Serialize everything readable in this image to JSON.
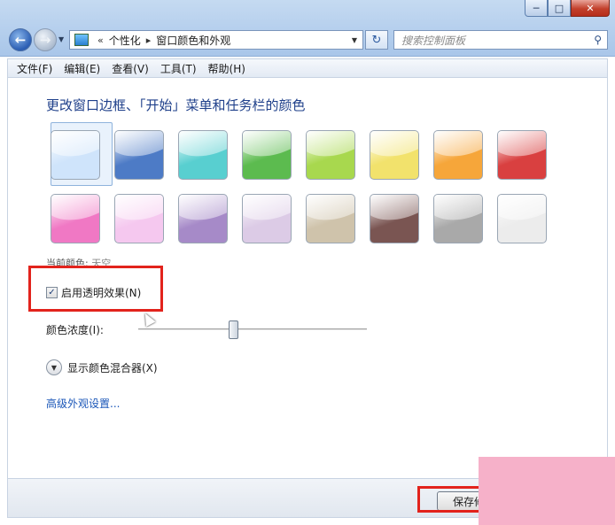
{
  "window": {
    "controls": {
      "minimize": "─",
      "maximize": "□",
      "close": "✕"
    }
  },
  "nav": {
    "back_icon": "back-arrow-icon",
    "forward_icon": "forward-arrow-icon"
  },
  "address": {
    "overflow": "«",
    "crumbs": [
      "个性化",
      "窗口颜色和外观"
    ],
    "separator": "▸"
  },
  "search": {
    "placeholder": "搜索控制面板"
  },
  "menu": {
    "items": [
      "文件(F)",
      "编辑(E)",
      "查看(V)",
      "工具(T)",
      "帮助(H)"
    ]
  },
  "main": {
    "title": "更改窗口边框、「开始」菜单和任务栏的颜色",
    "swatches": [
      {
        "name": "sky",
        "color": "#cfe4fb",
        "selected": true
      },
      {
        "name": "twilight",
        "color": "#4d7bc6"
      },
      {
        "name": "sea",
        "color": "#58cfd0"
      },
      {
        "name": "leaf",
        "color": "#5cbb4f"
      },
      {
        "name": "lime",
        "color": "#a8d84e"
      },
      {
        "name": "lemon",
        "color": "#f2e26c"
      },
      {
        "name": "pumpkin",
        "color": "#f6a63a"
      },
      {
        "name": "ruby",
        "color": "#d94040"
      },
      {
        "name": "fuchsia",
        "color": "#f078c4"
      },
      {
        "name": "blush",
        "color": "#f5c8ef"
      },
      {
        "name": "violet",
        "color": "#a68ac8"
      },
      {
        "name": "lavender",
        "color": "#dccbe6"
      },
      {
        "name": "taupe",
        "color": "#cfc3ab"
      },
      {
        "name": "chocolate",
        "color": "#7a5552"
      },
      {
        "name": "slate",
        "color": "#a9a9a9"
      },
      {
        "name": "frost",
        "color": "#ececec"
      }
    ],
    "current_color_label": "当前颜色:",
    "current_color_value": "天空",
    "transparency_label": "启用透明效果(N)",
    "transparency_checked": true,
    "intensity_label": "颜色浓度(I):",
    "intensity_level": 0.42,
    "mixer_label": "显示颜色混合器(X)",
    "advanced_link": "高级外观设置..."
  },
  "footer": {
    "save_label": "保存修"
  },
  "accent": {
    "highlight_red": "#e2231c",
    "link_blue": "#1a56b8",
    "title_blue": "#1e3f8a"
  }
}
